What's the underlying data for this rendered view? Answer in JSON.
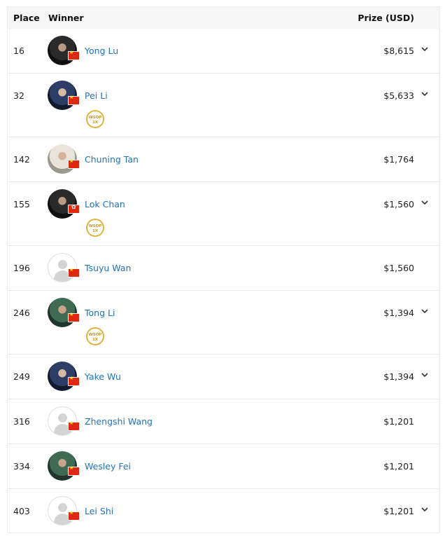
{
  "header": {
    "place": "Place",
    "winner": "Winner",
    "prize": "Prize (USD)"
  },
  "badge_text": {
    "line1": "WSOP",
    "line2": "1X"
  },
  "rows": [
    {
      "place": "16",
      "name": "Yong Lu",
      "prize": "$8,615",
      "flag": "china",
      "avatar": "photo",
      "expandable": true,
      "badge": false
    },
    {
      "place": "32",
      "name": "Pei Li",
      "prize": "$5,633",
      "flag": "china",
      "avatar": "photo",
      "expandable": true,
      "badge": true
    },
    {
      "place": "142",
      "name": "Chuning Tan",
      "prize": "$1,764",
      "flag": "china",
      "avatar": "photo",
      "expandable": false,
      "badge": false
    },
    {
      "place": "155",
      "name": "Lok Chan",
      "prize": "$1,560",
      "flag": "hong-kong",
      "avatar": "photo",
      "expandable": true,
      "badge": true
    },
    {
      "place": "196",
      "name": "Tsuyu Wan",
      "prize": "$1,560",
      "flag": "china",
      "avatar": "placeholder",
      "expandable": false,
      "badge": false
    },
    {
      "place": "246",
      "name": "Tong Li",
      "prize": "$1,394",
      "flag": "china",
      "avatar": "photo",
      "expandable": true,
      "badge": true
    },
    {
      "place": "249",
      "name": "Yake Wu",
      "prize": "$1,394",
      "flag": "china",
      "avatar": "photo",
      "expandable": true,
      "badge": false
    },
    {
      "place": "316",
      "name": "Zhengshi Wang",
      "prize": "$1,201",
      "flag": "china",
      "avatar": "placeholder",
      "expandable": false,
      "badge": false
    },
    {
      "place": "334",
      "name": "Wesley Fei",
      "prize": "$1,201",
      "flag": "china",
      "avatar": "photo",
      "expandable": false,
      "badge": false
    },
    {
      "place": "403",
      "name": "Lei Shi",
      "prize": "$1,201",
      "flag": "china",
      "avatar": "placeholder",
      "expandable": true,
      "badge": false
    }
  ],
  "colors": {
    "link": "#1f72b8",
    "badge_gold": "#e0b442",
    "header_bg": "#f6f6f6"
  }
}
